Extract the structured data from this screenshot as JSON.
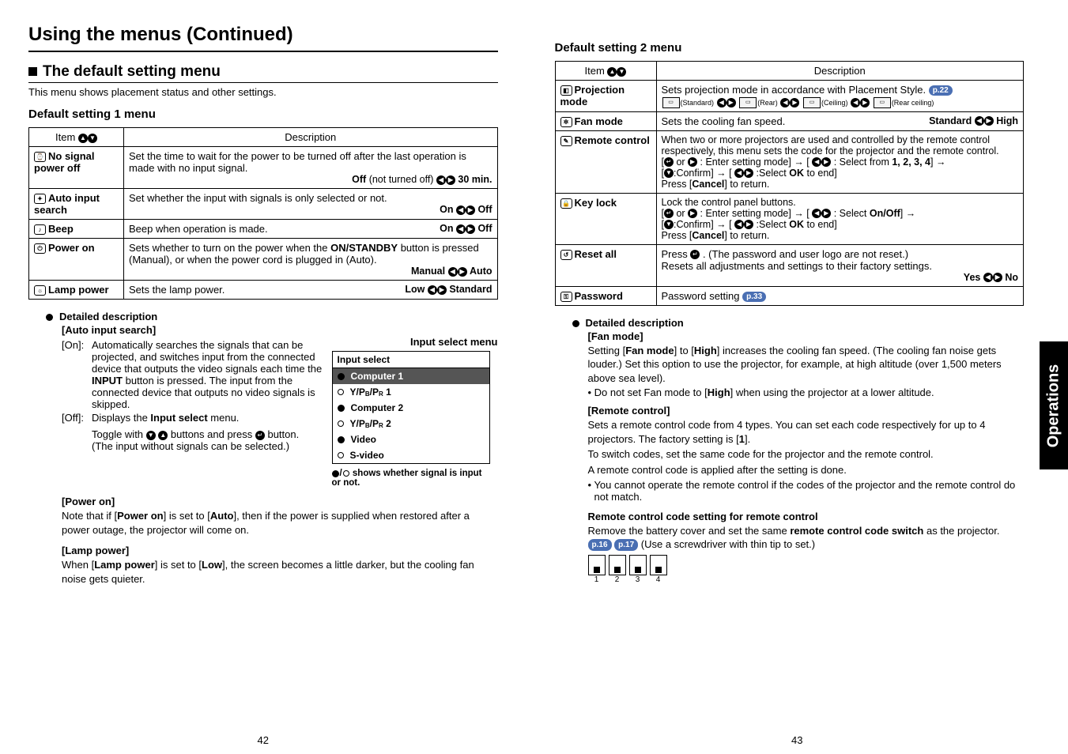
{
  "sidebar_label": "Operations",
  "left": {
    "page_num": "42",
    "main_title": "Using the menus (Continued)",
    "section_title": "The default setting menu",
    "section_sub": "This menu shows placement status and other settings.",
    "menu1_title": "Default setting 1 menu",
    "th_item": "Item",
    "th_desc": "Description",
    "rows": [
      {
        "name": "No signal power off",
        "desc": "Set the time to wait for the power to be turned off after the last operation is made with no input signal.",
        "toggle_left": "Off",
        "toggle_note": "(not turned off)",
        "toggle_right": "30 min."
      },
      {
        "name": "Auto input search",
        "desc": "Set whether the input with signals is only selected or not.",
        "toggle_left": "On",
        "toggle_note": "",
        "toggle_right": "Off"
      },
      {
        "name": "Beep",
        "desc": "Beep when operation is made.",
        "toggle_left": "On",
        "toggle_note": "",
        "toggle_right": "Off"
      },
      {
        "name": "Power on",
        "desc": "Sets whether to turn on the power when the ON/STANDBY button is pressed (Manual), or when the power cord is plugged in (Auto).",
        "on_bold": "ON/STANDBY",
        "toggle_left": "Manual",
        "toggle_note": "",
        "toggle_right": "Auto"
      },
      {
        "name": "Lamp power",
        "desc": "Sets the lamp power.",
        "toggle_left": "Low",
        "toggle_note": "",
        "toggle_right": "Standard"
      }
    ],
    "detailed_label": "Detailed description",
    "auto_input_label": "[Auto input search]",
    "on_label": "[On]:",
    "on_body": "Automatically searches the signals that can be projected, and switches input from the connected device that outputs the video signals each time the INPUT button is pressed. The input from the connected device that outputs no video signals is skipped.",
    "input_word": "INPUT",
    "off_label": "[Off]:",
    "off_body1": "Displays the Input select menu.",
    "input_select_bold": "Input select",
    "off_body2": "Toggle with ▼ ▲ buttons and press ● button. (The input without signals can be selected.)",
    "input_select_title": "Input select menu",
    "inset": {
      "header": "Input select",
      "items": [
        "Computer 1",
        "Y/PB/PR 1",
        "Computer 2",
        "Y/PB/PR 2",
        "Video",
        "S-video"
      ]
    },
    "inset_note": "●/○ shows whether signal is input or not.",
    "poweron_h": "[Power on]",
    "poweron_body": "Note that if [Power on] is set to [Auto], then if the power is supplied when restored after a power outage, the projector will come on.",
    "pon_b1": "Power on",
    "pon_b2": "Auto",
    "lamp_h": "[Lamp power]",
    "lamp_body": "When [Lamp power] is set to [Low], the screen becomes a little darker, but the cooling fan noise gets quieter.",
    "lamp_b1": "Lamp power",
    "lamp_b2": "Low"
  },
  "right": {
    "page_num": "43",
    "menu2_title": "Default setting 2 menu",
    "th_item": "Item",
    "th_desc": "Description",
    "rows": {
      "proj": {
        "name": "Projection mode",
        "desc": "Sets projection mode in accordance with Placement Style.",
        "ref": "p.22",
        "m1": "(Standard)",
        "m2": "(Rear)",
        "m3": "(Ceiling)",
        "m4": "(Rear ceiling)"
      },
      "fan": {
        "name": "Fan mode",
        "desc": "Sets the cooling fan speed.",
        "toggle_left": "Standard",
        "toggle_right": "High"
      },
      "remote": {
        "name": "Remote control",
        "desc1": "When two or more projectors are used and controlled by the remote control respectively, this menu sets the code for the projector and the remote control.",
        "l2a": "[",
        "l2b": " or ",
        "l2c": " : Enter setting mode] → [ ",
        "l2d": " : Select from ",
        "nums": "1, 2, 3, 4",
        "l2e": "] →",
        "l3a": "[",
        "l3b": ":Confirm] → [ ",
        "l3c": " :Select ",
        "ok": "OK",
        "l3d": " to end]",
        "l4": "Press [",
        "cancel": "Cancel",
        "l4b": "] to return."
      },
      "key": {
        "name": "Key lock",
        "desc1": "Lock the control panel buttons.",
        "l2a": "[",
        "l2b": " or ",
        "l2c": " : Enter setting mode] → [ ",
        "l2d": " : Select ",
        "onoff": "On/Off",
        "l2e": "] →",
        "l3a": "[",
        "l3b": ":Confirm] → [ ",
        "l3c": " :Select ",
        "ok": "OK",
        "l3d": " to end]",
        "l4": "Press [",
        "cancel": "Cancel",
        "l4b": "] to return."
      },
      "reset": {
        "name": "Reset all",
        "desc1": "Press ",
        "desc1b": " . (The password and user logo are not reset.)",
        "desc2": "Resets all adjustments and settings to their factory settings.",
        "toggle_left": "Yes",
        "toggle_right": "No"
      },
      "pwd": {
        "name": "Password",
        "desc": "Password setting",
        "ref": "p.33"
      }
    },
    "detailed_label": "Detailed description",
    "fan_h": "[Fan mode]",
    "fan_b1": "Setting [",
    "fan_w1": "Fan mode",
    "fan_b2": "] to [",
    "fan_w2": "High",
    "fan_b3": "] increases the cooling fan speed. (The cooling fan noise gets louder.) Set this option to use the projector, for example, at high altitude (over 1,500 meters above sea level).",
    "fan_bullet": "Do not set Fan mode to [",
    "fan_bullet_w": "High",
    "fan_bullet2": "] when using the projector at a lower altitude.",
    "rc_h": "[Remote control]",
    "rc_p1": "Sets a remote control code from 4 types. You can set each code respectively for up to 4 projectors. The factory setting is [",
    "rc_p1w": "1",
    "rc_p1b": "].",
    "rc_p2": "To switch codes, set the same code for the projector and the remote control.",
    "rc_p3": "A remote control code is applied after the setting is done.",
    "rc_bullet": "You cannot operate the remote control if the codes of the projector and the remote control do not match.",
    "rccs_h": "Remote control code setting for remote control",
    "rccs_p": "Remove the battery cover and set the same ",
    "rccs_w": "remote control code switch",
    "rccs_p2": " as the projector. ",
    "ref1": "p.16",
    "ref2": "p.17",
    "rccs_p3": " (Use a screwdriver with thin tip to set.)",
    "switch_nums": [
      "1",
      "2",
      "3",
      "4"
    ]
  }
}
